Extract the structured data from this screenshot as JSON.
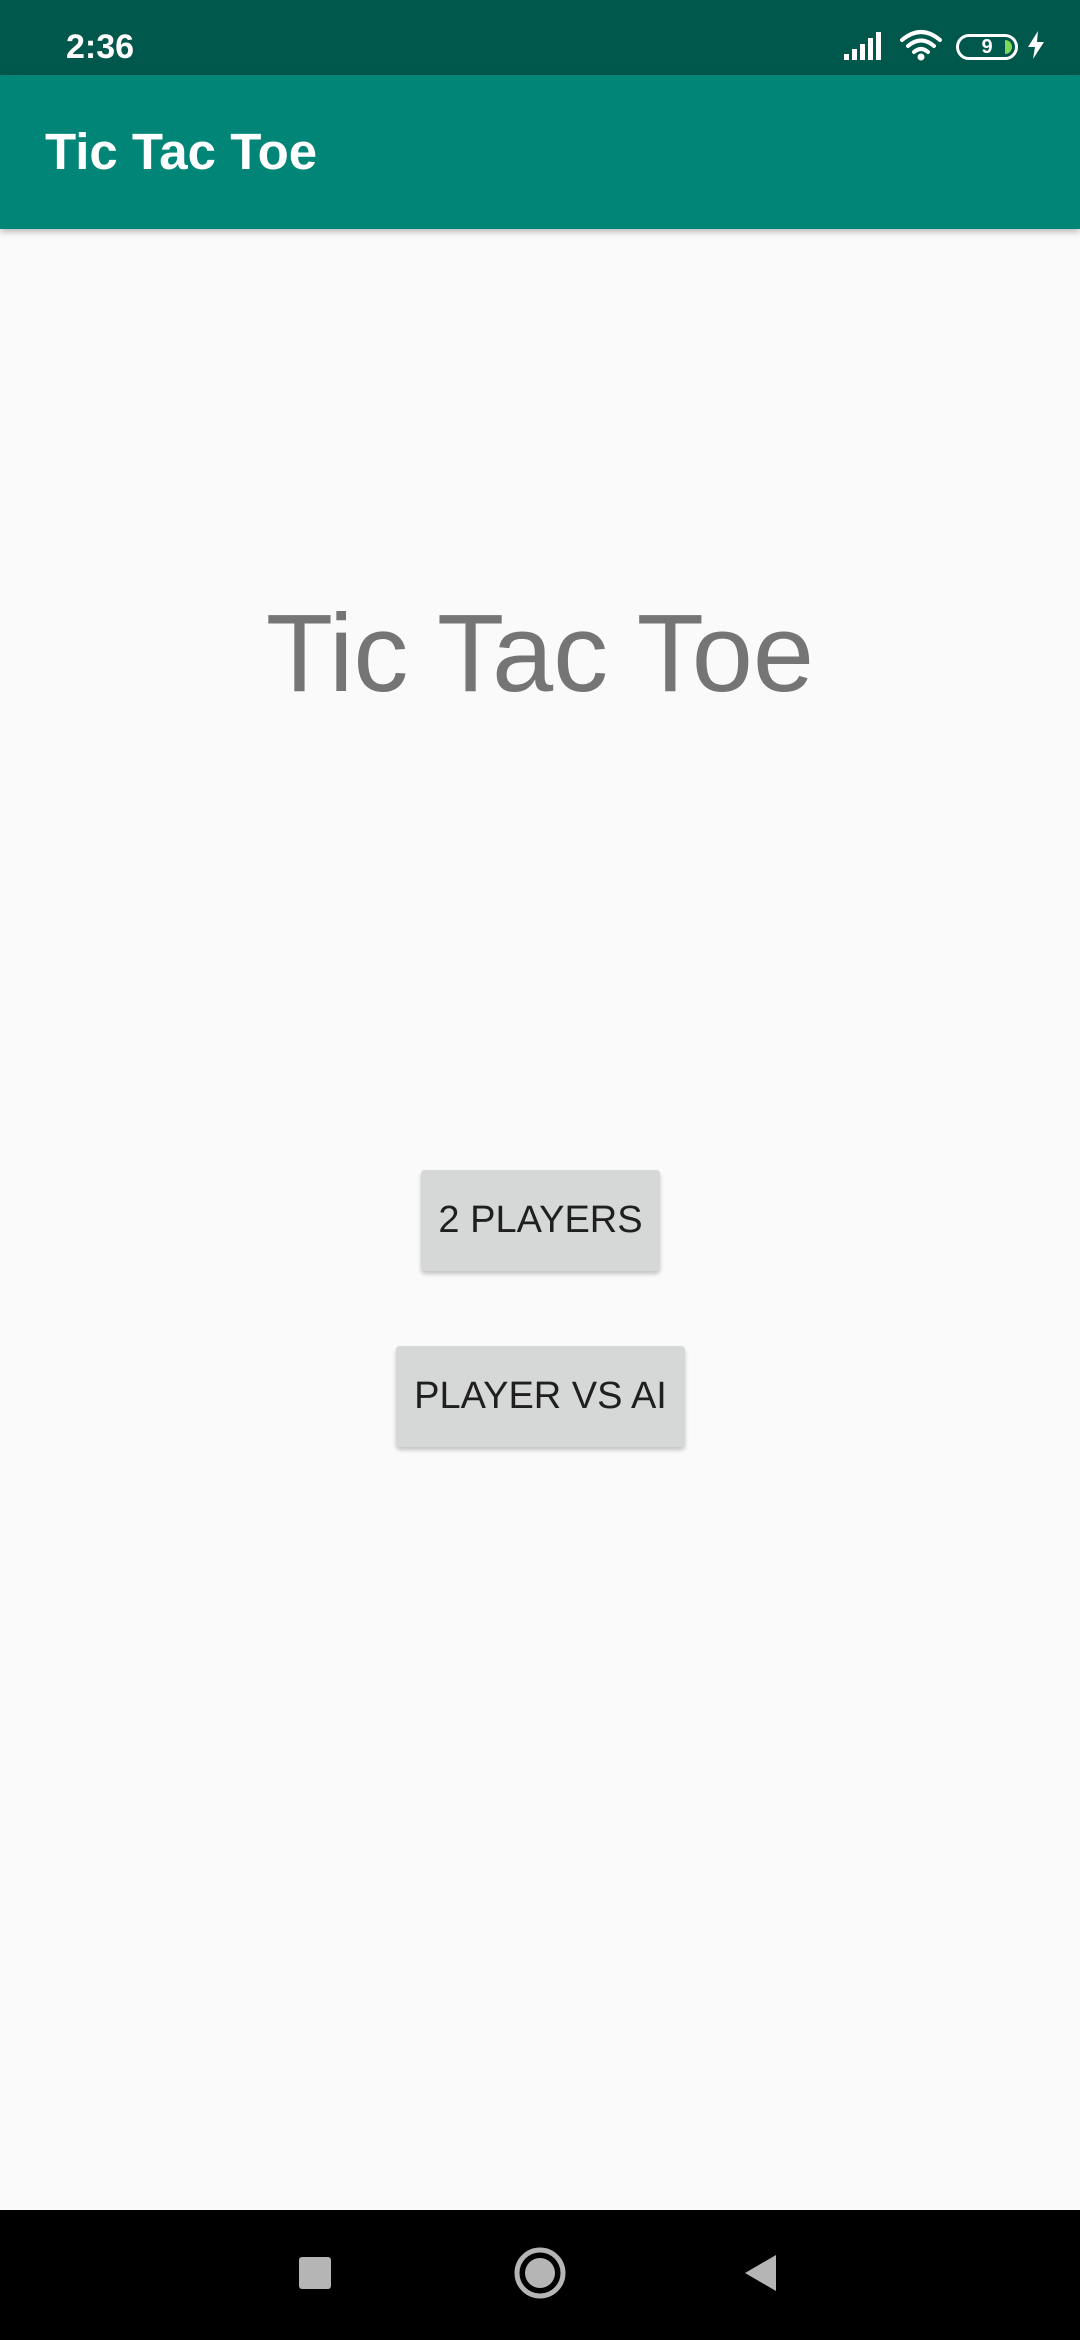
{
  "status_bar": {
    "time": "2:36",
    "battery_level": "9",
    "icons": [
      "signal-icon",
      "wifi-icon",
      "battery-icon",
      "charging-icon"
    ]
  },
  "app_bar": {
    "title": "Tic Tac Toe"
  },
  "main": {
    "headline": "Tic Tac Toe",
    "buttons": {
      "two_players": "2 PLAYERS",
      "player_vs_ai": "PLAYER VS AI"
    }
  },
  "nav_bar": {
    "icons": [
      "recents-icon",
      "home-icon",
      "back-icon"
    ]
  },
  "colors": {
    "status_bar": "#00574b",
    "app_bar": "#008577",
    "background": "#fafafa",
    "headline_text": "#757575",
    "button_bg": "#d6d7d7",
    "button_text": "#1f1f1f",
    "nav_bar": "#000000"
  }
}
